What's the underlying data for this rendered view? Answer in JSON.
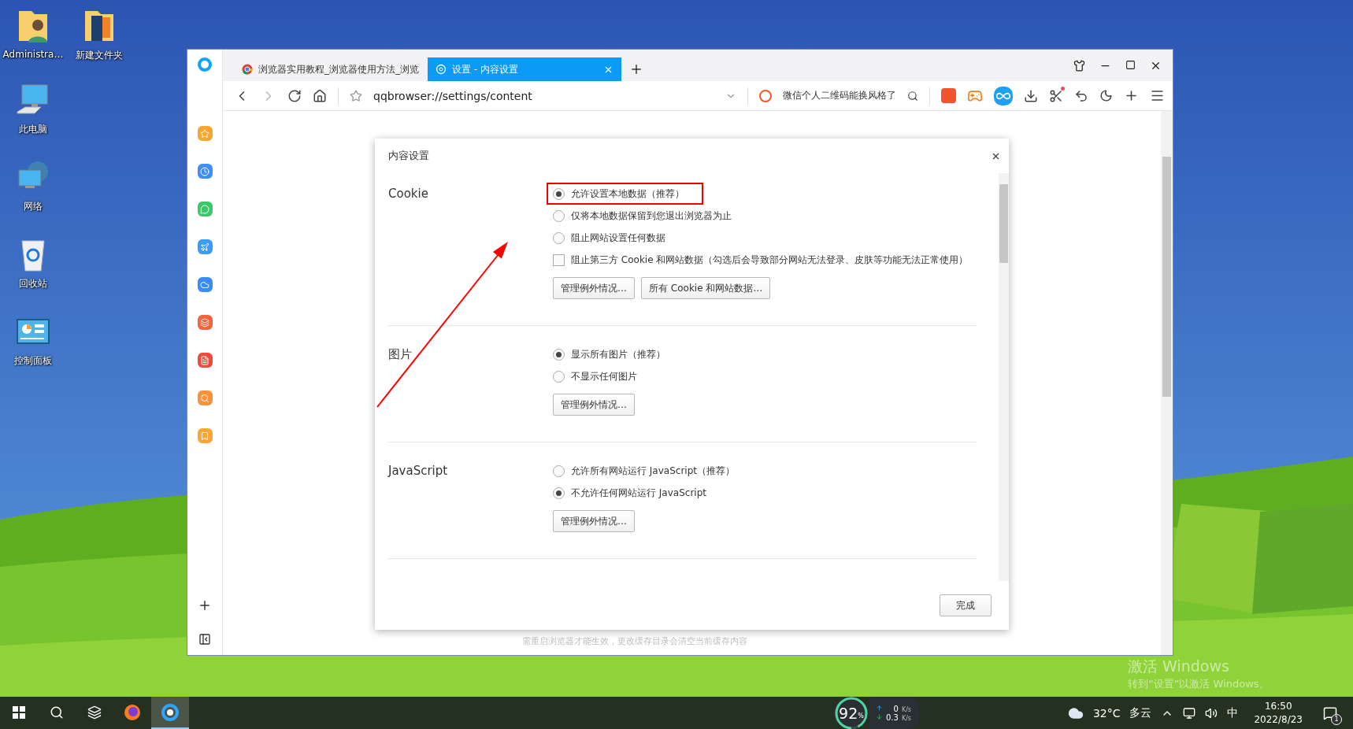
{
  "desktop_icons": [
    {
      "label": "Administra…"
    },
    {
      "label": "新建文件夹"
    },
    {
      "label": "此电脑"
    },
    {
      "label": "网络"
    },
    {
      "label": "回收站"
    },
    {
      "label": "控制面板"
    }
  ],
  "browser": {
    "tabs": [
      {
        "title": "浏览器实用教程_浏览器使用方法_浏览",
        "selected": false
      },
      {
        "title": "设置 - 内容设置",
        "selected": true
      }
    ],
    "address": "qqbrowser://settings/content",
    "search": {
      "placeholder": "微信个人二维码能换风格了"
    },
    "dialog": {
      "title": "内容设置",
      "sections": [
        {
          "label": "Cookie",
          "options": [
            {
              "kind": "radio",
              "label": "允许设置本地数据（推荐）",
              "selected": true,
              "highlighted": true
            },
            {
              "kind": "radio",
              "label": "仅将本地数据保留到您退出浏览器为止",
              "selected": false,
              "highlighted": false
            },
            {
              "kind": "radio",
              "label": "阻止网站设置任何数据",
              "selected": false,
              "highlighted": false
            },
            {
              "kind": "checkbox",
              "label": "阻止第三方 Cookie 和网站数据（勾选后会导致部分网站无法登录、皮肤等功能无法正常使用）",
              "checked": false,
              "highlighted": false
            }
          ],
          "buttons": [
            "管理例外情况…",
            "所有 Cookie 和网站数据…"
          ]
        },
        {
          "label": "图片",
          "options": [
            {
              "kind": "radio",
              "label": "显示所有图片（推荐）",
              "selected": true,
              "highlighted": false
            },
            {
              "kind": "radio",
              "label": "不显示任何图片",
              "selected": false,
              "highlighted": false
            }
          ],
          "buttons": [
            "管理例外情况…"
          ]
        },
        {
          "label": "JavaScript",
          "options": [
            {
              "kind": "radio",
              "label": "允许所有网站运行 JavaScript（推荐）",
              "selected": false,
              "highlighted": false
            },
            {
              "kind": "radio",
              "label": "不允许任何网站运行 JavaScript",
              "selected": true,
              "highlighted": false
            }
          ],
          "buttons": [
            "管理例外情况…"
          ]
        }
      ],
      "done_button": "完成"
    },
    "page_note": "需重启浏览器才能生效，更改缓存目录会清空当前缓存内容"
  },
  "activation_notice": {
    "title": "激活 Windows",
    "hint": "转到“设置”以激活 Windows。"
  },
  "taskbar": {
    "apps": [
      {
        "kind": "firefox",
        "selected": false
      },
      {
        "kind": "browser",
        "selected": true
      }
    ],
    "monitor": {
      "value": "92",
      "unit": "%",
      "upload": "0",
      "upload_unit": "K/s",
      "download": "0.3",
      "download_unit": "K/s"
    },
    "weather": {
      "temperature": "32°C",
      "condition": "多云"
    },
    "ime": "中",
    "time": "16:50",
    "date": "2022/8/23",
    "notifications": "1"
  }
}
